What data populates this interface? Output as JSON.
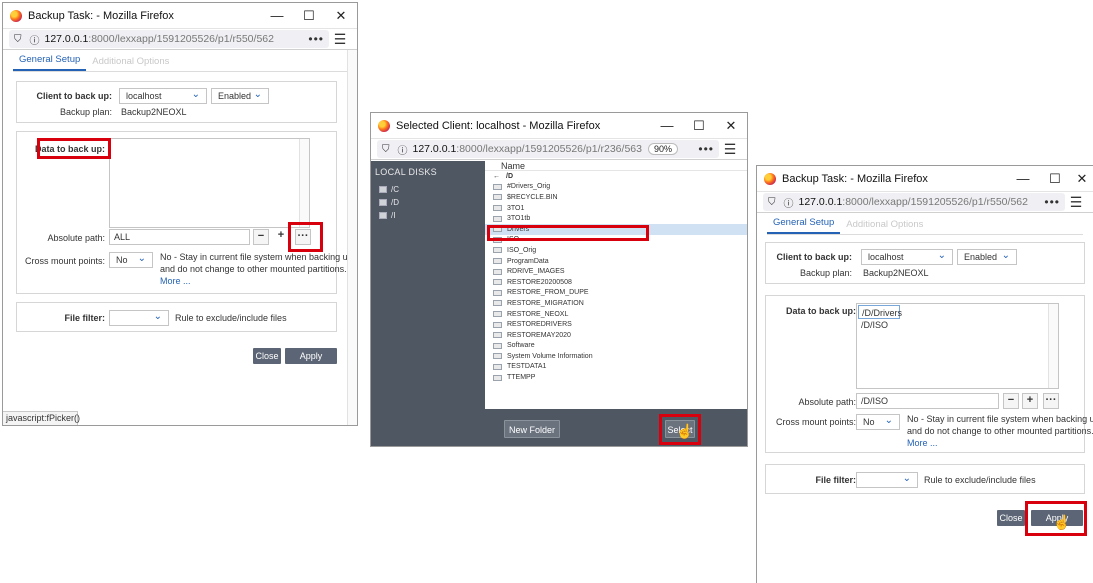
{
  "win1": {
    "title": "Backup Task: - Mozilla Firefox",
    "url_host": "127.0.0.1",
    "url_path": ":8000/lexxapp/1591205526/p1/r550/562",
    "tabs": [
      "General Setup",
      "Additional Options"
    ],
    "client_label": "Client to back up:",
    "client_value": "localhost",
    "enabled_value": "Enabled",
    "plan_label": "Backup plan:",
    "plan_value": "Backup2NEOXL",
    "data_label": "Data to back up:",
    "abs_label": "Absolute path:",
    "abs_value": "ALL",
    "minus": "−",
    "plus": "+",
    "ellipsis": "···",
    "cross_label": "Cross mount points:",
    "cross_value": "No",
    "cross_desc1": "No - Stay in current file system when backing up",
    "cross_desc2": "and do not change to other mounted partitions.",
    "more": "More ...",
    "filter_label": "File filter:",
    "filter_desc": "Rule to exclude/include files",
    "close": "Close",
    "apply": "Apply",
    "status": "javascript:fPicker()"
  },
  "win2": {
    "title": "Selected Client: localhost - Mozilla Firefox",
    "url_host": "127.0.0.1",
    "url_path": ":8000/lexxapp/1591205526/p1/r236/563",
    "zoom": "90%",
    "sidebar_title": "LOCAL DISKS",
    "disks": [
      "/C",
      "/D",
      "/I"
    ],
    "name_header": "Name",
    "current_dir": "/D",
    "folders": [
      "#Drivers_Orig",
      "$RECYCLE.BIN",
      "3TO1",
      "3TO1tb",
      "Drivers",
      "ISO",
      "ISO_Orig",
      "ProgramData",
      "RDRIVE_IMAGES",
      "RESTORE20200508",
      "RESTORE_FROM_DUPE",
      "RESTORE_MIGRATION",
      "RESTORE_NEOXL",
      "RESTOREDRIVERS",
      "RESTOREMAY2020",
      "Software",
      "System Volume Information",
      "TESTDATA1",
      "TTEMPP"
    ],
    "new_folder": "New Folder",
    "select": "Select"
  },
  "win3": {
    "title": "Backup Task: - Mozilla Firefox",
    "url_host": "127.0.0.1",
    "url_path": ":8000/lexxapp/1591205526/p1/r550/562",
    "tabs": [
      "General Setup",
      "Additional Options"
    ],
    "client_label": "Client to back up:",
    "client_value": "localhost",
    "enabled_value": "Enabled",
    "plan_label": "Backup plan:",
    "plan_value": "Backup2NEOXL",
    "data_label": "Data to back up:",
    "data_lines": [
      "/D/Drivers",
      "/D/ISO"
    ],
    "abs_label": "Absolute path:",
    "abs_value": "/D/ISO",
    "minus": "−",
    "plus": "+",
    "ellipsis": "···",
    "cross_label": "Cross mount points:",
    "cross_value": "No",
    "cross_desc1": "No - Stay in current file system when backing up",
    "cross_desc2": "and do not change to other mounted partitions.",
    "more": "More ...",
    "filter_label": "File filter:",
    "filter_desc": "Rule to exclude/include files",
    "close": "Close",
    "apply": "Apply"
  },
  "icons": {
    "minimize": "—",
    "maximize": "☐",
    "close": "✕",
    "shield": "⛉",
    "info": "ⓘ",
    "menu": "☰",
    "more_dots": "•••",
    "chevron": "⌄",
    "back_arrow": "←",
    "hand": "☝"
  },
  "colors": {
    "accent": "#2462b5",
    "highlight": "#d9000d",
    "sidebar": "#4f5763",
    "button": "#5b6575"
  }
}
